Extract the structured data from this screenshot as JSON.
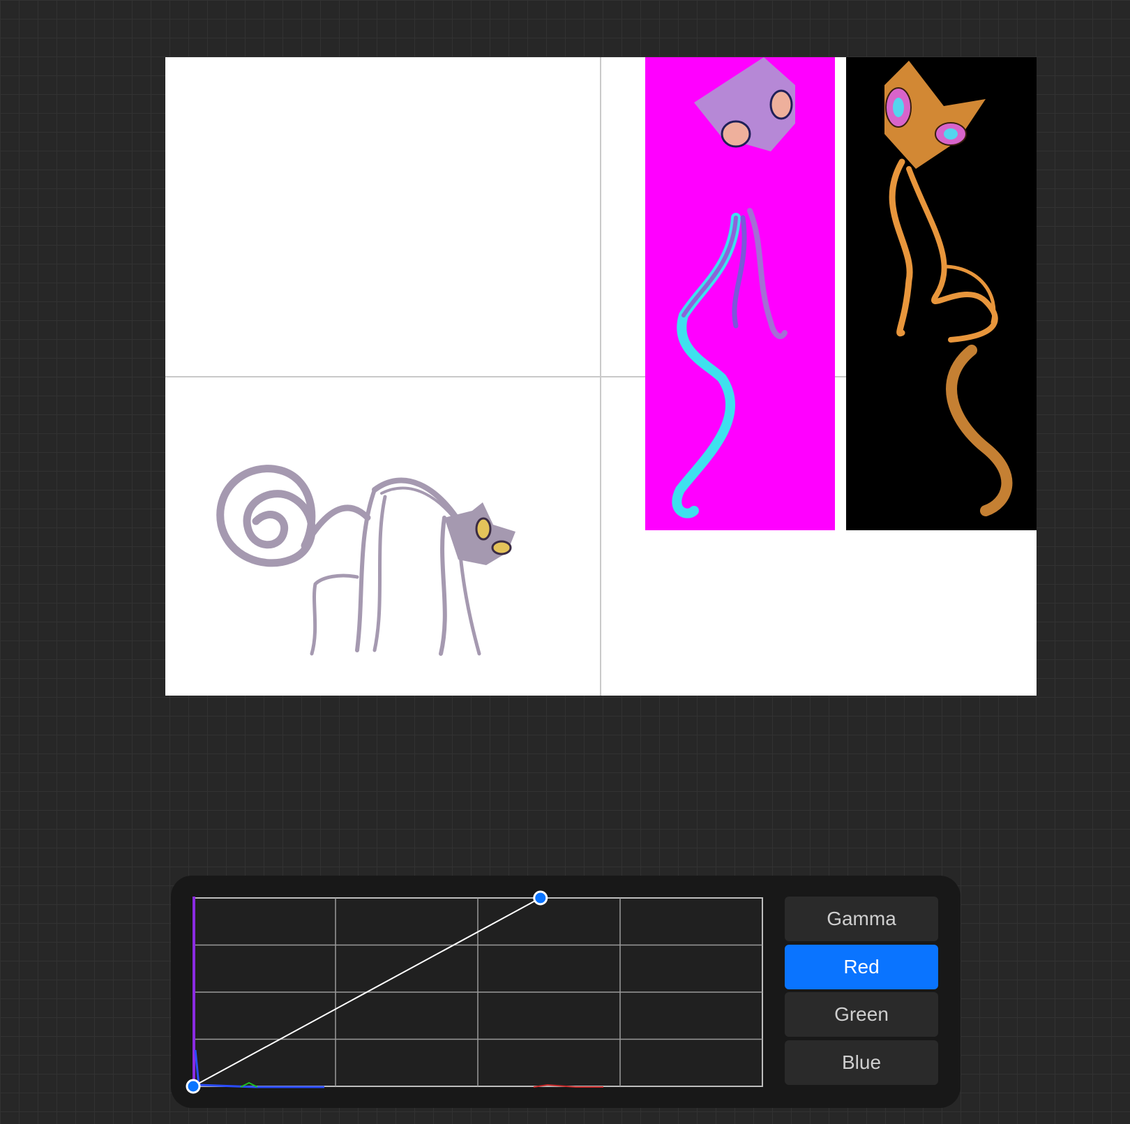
{
  "curves": {
    "channels": [
      "Gamma",
      "Red",
      "Green",
      "Blue"
    ],
    "selected_channel": "Red",
    "grid_divisions": 4,
    "curve_points": [
      [
        0,
        0
      ],
      [
        0.61,
        1
      ]
    ]
  },
  "colors": {
    "workspace": "#272727",
    "panel": "#181818",
    "accent": "#0a74ff",
    "button": "#2a2a2a",
    "magenta_layer": "#ff00ff",
    "black_layer": "#000000",
    "grey_cat": "#a599b0",
    "orange_cat": "#e8963c"
  }
}
